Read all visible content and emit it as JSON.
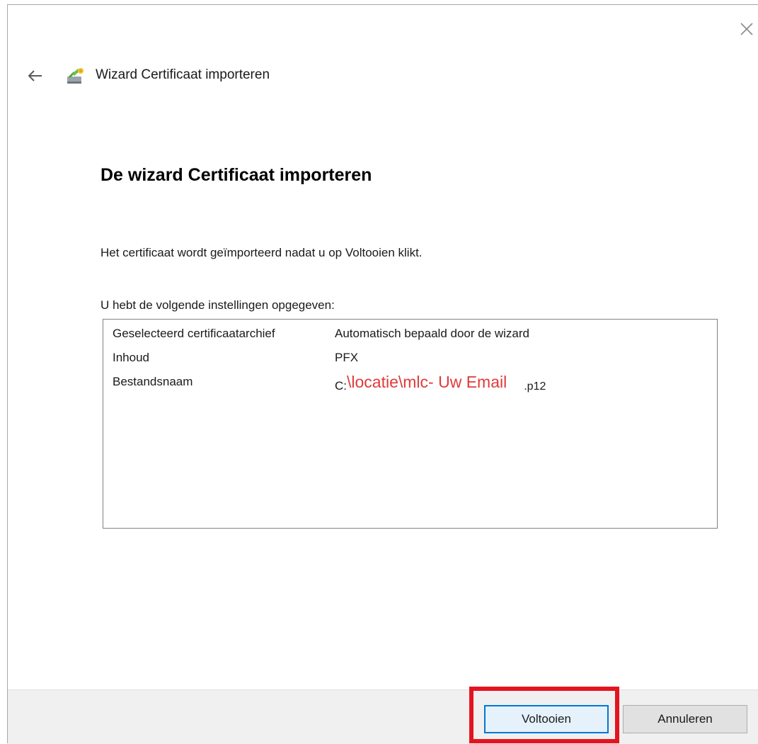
{
  "window": {
    "caption": "Wizard Certificaat importeren",
    "close_icon": "close-icon",
    "back_icon": "arrow-left-icon",
    "wizard_icon": "certificate-import-icon"
  },
  "main": {
    "heading": "De wizard Certificaat importeren",
    "intro": "Het certificaat wordt geïmporteerd nadat u op Voltooien klikt.",
    "settings_label": "U hebt de volgende instellingen opgegeven:",
    "settings": [
      {
        "key": "Geselecteerd certificaatarchief",
        "value": "Automatisch bepaald door de wizard"
      },
      {
        "key": "Inhoud",
        "value": "PFX"
      },
      {
        "key": "Bestandsnaam",
        "value_prefix": "C:",
        "value_highlight": "\\locatie\\mlc- Uw Email",
        "value_suffix": ".p12"
      }
    ]
  },
  "footer": {
    "finish_label": "Voltooien",
    "cancel_label": "Annuleren"
  },
  "colors": {
    "annotation_red": "#e4141f",
    "path_red": "#e03a3a",
    "focus_blue": "#0078d7"
  }
}
